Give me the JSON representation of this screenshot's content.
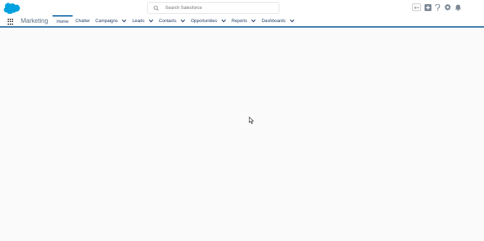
{
  "header": {
    "search_placeholder": "Search Salesforce",
    "icons": [
      "salesforce-logo",
      "search-icon",
      "favorites-icon",
      "add-icon",
      "help-icon",
      "settings-icon",
      "notifications-icon"
    ]
  },
  "nav": {
    "app_name": "Marketing",
    "tabs": [
      {
        "label": "Home"
      },
      {
        "label": "Chatter"
      },
      {
        "label": "Campaigns"
      },
      {
        "label": "Leads"
      },
      {
        "label": "Contacts"
      },
      {
        "label": "Opportunities"
      },
      {
        "label": "Reports"
      },
      {
        "label": "Dashboards"
      }
    ]
  },
  "colors": {
    "brand": "#00a1e0",
    "nav_border": "#236c9e",
    "tab_text": "#16325c",
    "app_name": "#5a6f84"
  }
}
